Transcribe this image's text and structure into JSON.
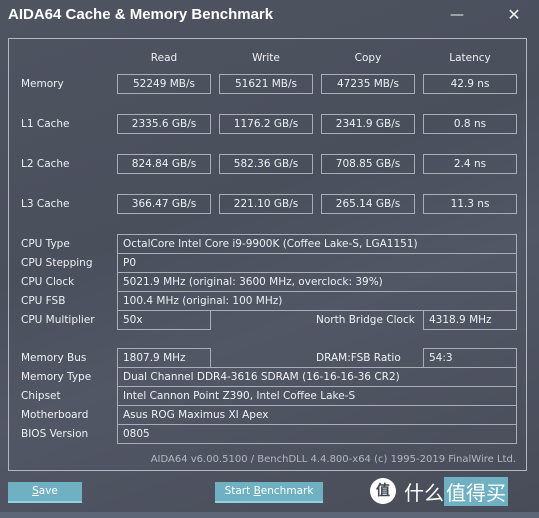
{
  "window": {
    "title": "AIDA64 Cache & Memory Benchmark",
    "minimize_icon": "minimize-icon",
    "close_icon": "close-icon",
    "minimize_glyph": "—",
    "close_glyph": "✕"
  },
  "benchmark": {
    "columns": [
      "Read",
      "Write",
      "Copy",
      "Latency"
    ],
    "rows": [
      {
        "label": "Memory",
        "values": [
          "52249 MB/s",
          "51621 MB/s",
          "47235 MB/s",
          "42.9 ns"
        ]
      },
      {
        "label": "L1 Cache",
        "values": [
          "2335.6 GB/s",
          "1176.2 GB/s",
          "2341.9 GB/s",
          "0.8 ns"
        ]
      },
      {
        "label": "L2 Cache",
        "values": [
          "824.84 GB/s",
          "582.36 GB/s",
          "708.85 GB/s",
          "2.4 ns"
        ]
      },
      {
        "label": "L3 Cache",
        "values": [
          "366.47 GB/s",
          "221.10 GB/s",
          "265.14 GB/s",
          "11.3 ns"
        ]
      }
    ]
  },
  "cpu": {
    "type_label": "CPU Type",
    "type_value": "OctalCore Intel Core i9-9900K  (Coffee Lake-S, LGA1151)",
    "stepping_label": "CPU Stepping",
    "stepping_value": "P0",
    "clock_label": "CPU Clock",
    "clock_value": "5021.9 MHz  (original: 3600 MHz, overclock: 39%)",
    "fsb_label": "CPU FSB",
    "fsb_value": "100.4 MHz  (original: 100 MHz)",
    "multiplier_label": "CPU Multiplier",
    "multiplier_value": "50x",
    "nb_clock_label": "North Bridge Clock",
    "nb_clock_value": "4318.9 MHz"
  },
  "memory": {
    "bus_label": "Memory Bus",
    "bus_value": "1807.9 MHz",
    "ratio_label": "DRAM:FSB Ratio",
    "ratio_value": "54:3",
    "type_label": "Memory Type",
    "type_value": "Dual Channel DDR4-3616 SDRAM  (16-16-16-36 CR2)",
    "chipset_label": "Chipset",
    "chipset_value": "Intel Cannon Point Z390, Intel Coffee Lake-S",
    "motherboard_label": "Motherboard",
    "motherboard_value": "Asus ROG Maximus XI Apex",
    "bios_label": "BIOS Version",
    "bios_value": "0805"
  },
  "footer": {
    "version_text": "AIDA64 v6.00.5100 / BenchDLL 4.4.800-x64  (c) 1995-2019 FinalWire Ltd."
  },
  "buttons": {
    "save_underlined": "S",
    "save_rest": "ave",
    "bench_prefix": "Start ",
    "bench_underlined": "B",
    "bench_rest": "enchmark"
  },
  "watermark": {
    "badge": "值",
    "text_plain": "什么",
    "text_highlight": "值得买"
  }
}
